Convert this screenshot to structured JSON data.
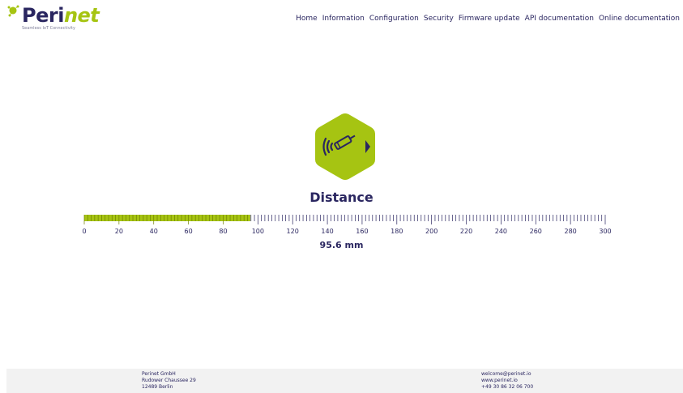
{
  "brand": {
    "name_part1": "Peri",
    "name_part2": "net",
    "tagline": "Seamless IoT Connectivity"
  },
  "nav": {
    "items": [
      "Home",
      "Information",
      "Configuration",
      "Security",
      "Firmware update",
      "API documentation",
      "Online documentation"
    ]
  },
  "sensor": {
    "icon": "distance-sensor-icon",
    "title": "Distance",
    "value": 95.6,
    "value_display": "95.6 mm",
    "scale": {
      "min": 0,
      "max": 300,
      "major_step": 20,
      "minor_step": 2,
      "labels": [
        "0",
        "20",
        "40",
        "60",
        "80",
        "100",
        "120",
        "140",
        "160",
        "180",
        "200",
        "220",
        "240",
        "260",
        "280",
        "300"
      ]
    }
  },
  "footer": {
    "company": "Perinet GmbH",
    "street": "Rudower Chaussee 29",
    "city": "12489 Berlin",
    "email": "welcome@perinet.io",
    "web": "www.perinet.io",
    "phone": "+49 30 86 32 06 700"
  },
  "colors": {
    "accent": "#a6c412",
    "navy": "#2a2660",
    "footer_bg": "#f2f2f2"
  }
}
